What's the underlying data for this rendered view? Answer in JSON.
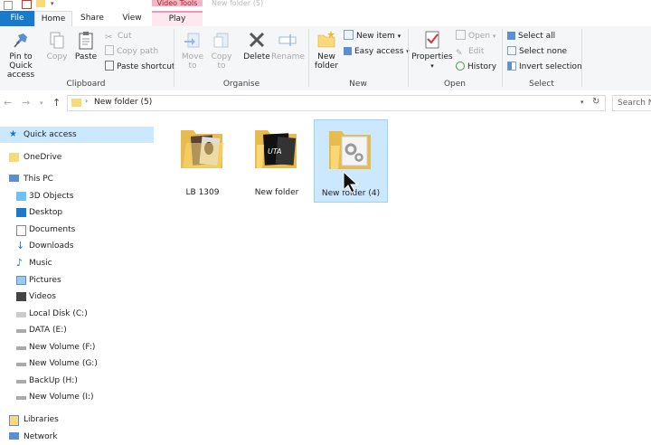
{
  "window": {
    "title": "New folder (5)",
    "contextual_tab_label": "Video Tools"
  },
  "tabs": [
    "File",
    "Home",
    "Share",
    "View",
    "Play"
  ],
  "ribbon": {
    "clipboard": {
      "label": "Clipboard",
      "pin": "Pin to Quick access",
      "pin_line1": "Pin to Quick",
      "pin_line2": "access",
      "copy": "Copy",
      "paste": "Paste",
      "cut": "Cut",
      "copy_path": "Copy path",
      "paste_shortcut": "Paste shortcut"
    },
    "organise": {
      "label": "Organise",
      "move_to": "Move to",
      "move_line1": "Move",
      "move_line2": "to",
      "copy_to": "Copy to",
      "copy_line1": "Copy",
      "copy_line2": "to",
      "delete": "Delete",
      "rename": "Rename"
    },
    "new": {
      "label": "New",
      "new_folder_line1": "New",
      "new_folder_line2": "folder",
      "new_item": "New item",
      "easy_access": "Easy access"
    },
    "open": {
      "label": "Open",
      "properties": "Properties",
      "open": "Open",
      "edit": "Edit",
      "history": "History"
    },
    "select": {
      "label": "Select",
      "select_all": "Select all",
      "select_none": "Select none",
      "invert_selection": "Invert selection"
    }
  },
  "address": {
    "path": "New folder (5)",
    "search_placeholder": "Search N"
  },
  "sidebar": {
    "quick_access": "Quick access",
    "onedrive": "OneDrive",
    "this_pc": "This PC",
    "items": [
      "3D Objects",
      "Desktop",
      "Documents",
      "Downloads",
      "Music",
      "Pictures",
      "Videos",
      "Local Disk (C:)",
      "DATA (E:)",
      "New Volume (F:)",
      "New Volume (G:)",
      "BackUp (H:)",
      "New Volume (I:)"
    ],
    "libraries": "Libraries",
    "network": "Network"
  },
  "files": [
    {
      "name": "LB 1309"
    },
    {
      "name": "New folder"
    },
    {
      "name": "New folder (4)"
    }
  ],
  "colors": {
    "accent": "#1979ca",
    "folder": "#f9d979",
    "selection": "#cce8ff"
  }
}
